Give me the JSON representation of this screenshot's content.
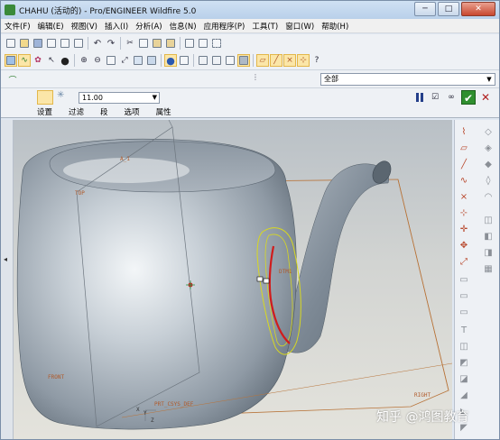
{
  "window": {
    "title": "CHAHU (活动的) - Pro/ENGINEER Wildfire 5.0",
    "minimize": "─",
    "maximize": "□",
    "close": "✕"
  },
  "menu": [
    "文件(F)",
    "编辑(E)",
    "视图(V)",
    "插入(I)",
    "分析(A)",
    "信息(N)",
    "应用程序(P)",
    "工具(T)",
    "窗口(W)",
    "帮助(H)"
  ],
  "filter": {
    "value": "全部"
  },
  "dashboard": {
    "value": "11.00",
    "tabs": [
      "设置",
      "过滤",
      "段",
      "选项",
      "属性"
    ]
  },
  "viewport_labels": {
    "top": "TOP",
    "front": "FRONT",
    "right": "RIGHT",
    "csys": "PRT_CSYS_DEF",
    "x": "X",
    "y": "Y",
    "z": "Z",
    "a1": "A_1",
    "dtm": "DTM1"
  },
  "watermark": "知乎 @鸿图教育"
}
